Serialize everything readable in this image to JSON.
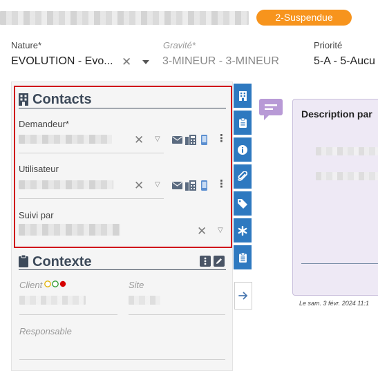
{
  "header": {
    "status": "2-Suspendue"
  },
  "fields": {
    "nature": {
      "label": "Nature*",
      "value": "EVOLUTION - Evo..."
    },
    "gravite": {
      "label": "Gravité*",
      "value": "3-MINEUR - 3-MINEUR"
    },
    "priorite": {
      "label": "Priorité",
      "value": "5-A - 5-Aucu"
    }
  },
  "contacts": {
    "title": "Contacts",
    "demandeur_label": "Demandeur*",
    "utilisateur_label": "Utilisateur",
    "suivi_label": "Suivi par"
  },
  "contexte": {
    "title": "Contexte",
    "client_label": "Client",
    "site_label": "Site",
    "responsable_label": "Responsable"
  },
  "description": {
    "title": "Description par",
    "timestamp": "Le sam. 3 févr. 2024 11:1"
  },
  "colors": {
    "status": "#f7941d",
    "accent": "#2e79c0",
    "highlight": "#d0111b",
    "note": "#b89ad6"
  },
  "icons": [
    "building-icon",
    "clipboard-icon",
    "info-icon",
    "paperclip-icon",
    "tag-icon",
    "asterisk-icon",
    "clipboard-list-icon",
    "arrow-right-icon",
    "note-icon",
    "envelope-icon",
    "fax-icon",
    "phone-icon",
    "kebab-icon",
    "edit-icon",
    "close-icon",
    "caret-icon",
    "traffic-light-icon"
  ]
}
